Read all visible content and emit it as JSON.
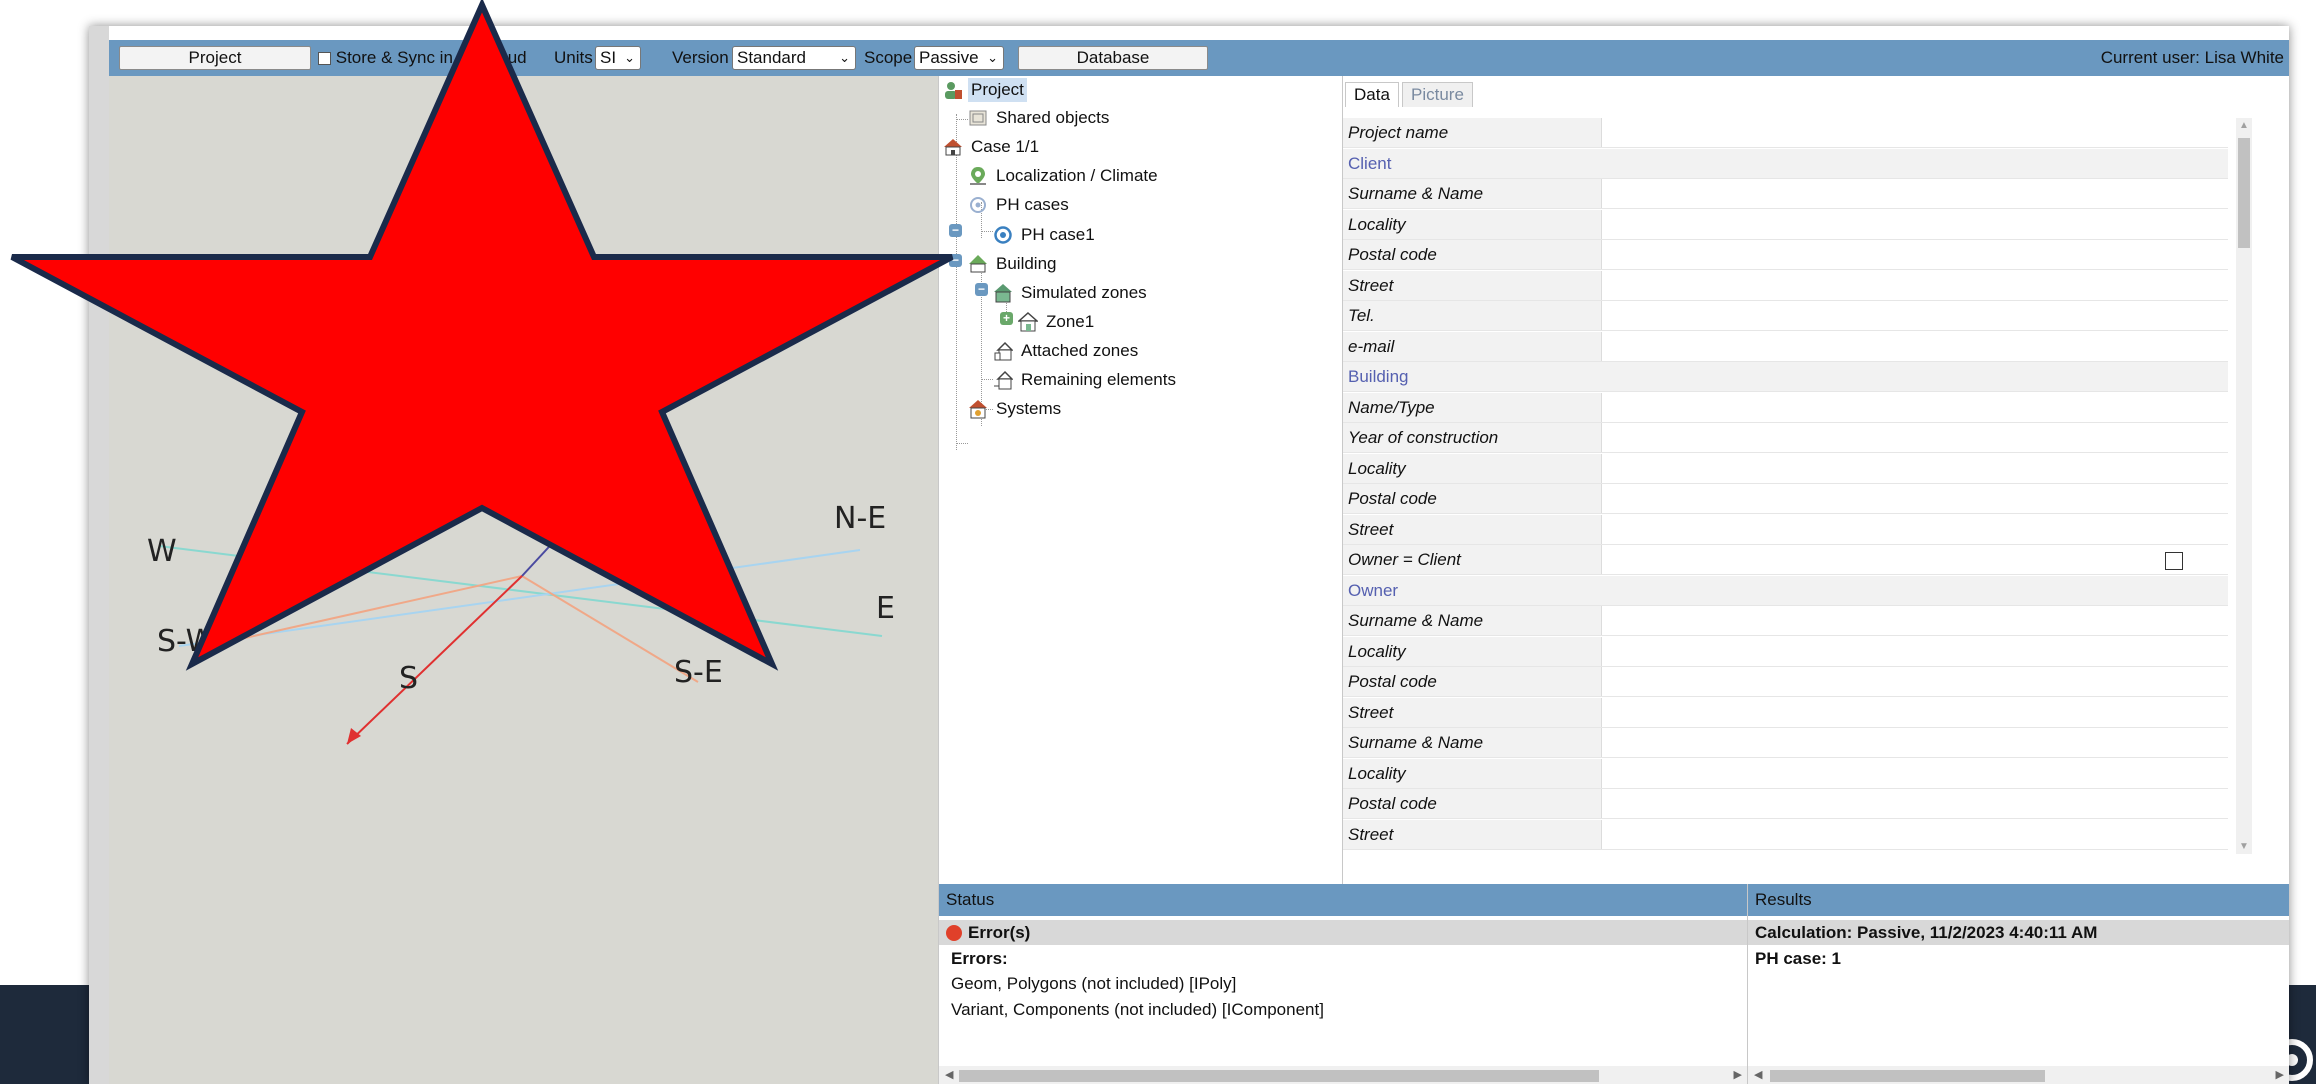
{
  "toolbar": {
    "project_button": "Project",
    "store_sync_label": "Store & Sync in the cloud",
    "units_label": "Units",
    "units_value": "SI",
    "version_label": "Version",
    "version_value": "Standard",
    "scope_label": "Scope",
    "scope_value": "Passive",
    "database_button": "Database",
    "current_user": "Current user: Lisa White"
  },
  "compass": {
    "labels": [
      "W",
      "N-E",
      "S-W",
      "E",
      "S",
      "S-E"
    ]
  },
  "tree": {
    "items": [
      {
        "label": "Project",
        "icon": "project-icon"
      },
      {
        "label": "Shared objects",
        "icon": "shared-objects-icon"
      },
      {
        "label": "Case 1/1",
        "icon": "case-icon"
      },
      {
        "label": "Localization / Climate",
        "icon": "location-pin-icon"
      },
      {
        "label": "PH cases",
        "icon": "ph-cases-icon"
      },
      {
        "label": "PH case1",
        "icon": "ph-case-icon"
      },
      {
        "label": "Building",
        "icon": "building-icon"
      },
      {
        "label": "Simulated zones",
        "icon": "simulated-zones-icon"
      },
      {
        "label": "Zone1",
        "icon": "zone-icon"
      },
      {
        "label": "Attached zones",
        "icon": "attached-zones-icon"
      },
      {
        "label": "Remaining elements",
        "icon": "remaining-elements-icon"
      },
      {
        "label": "Systems",
        "icon": "systems-icon"
      }
    ]
  },
  "data_panel": {
    "tabs": [
      "Data",
      "Picture"
    ],
    "rows": [
      {
        "label": "Project name",
        "type": "field"
      },
      {
        "label": "Client",
        "type": "section"
      },
      {
        "label": "Surname & Name",
        "type": "field"
      },
      {
        "label": "Locality",
        "type": "field"
      },
      {
        "label": "Postal code",
        "type": "field"
      },
      {
        "label": "Street",
        "type": "field"
      },
      {
        "label": "Tel.",
        "type": "field"
      },
      {
        "label": "e-mail",
        "type": "field"
      },
      {
        "label": "Building",
        "type": "section"
      },
      {
        "label": "Name/Type",
        "type": "field"
      },
      {
        "label": "Year of construction",
        "type": "field"
      },
      {
        "label": "Locality",
        "type": "field"
      },
      {
        "label": "Postal code",
        "type": "field"
      },
      {
        "label": "Street",
        "type": "field"
      },
      {
        "label": "Owner = Client",
        "type": "checkbox",
        "checked": false
      },
      {
        "label": "Owner",
        "type": "section"
      },
      {
        "label": "Surname & Name",
        "type": "field"
      },
      {
        "label": "Locality",
        "type": "field"
      },
      {
        "label": "Postal code",
        "type": "field"
      },
      {
        "label": "Street",
        "type": "field"
      },
      {
        "label": "Surname & Name",
        "type": "field"
      },
      {
        "label": "Locality",
        "type": "field"
      },
      {
        "label": "Postal code",
        "type": "field"
      },
      {
        "label": "Street",
        "type": "field"
      }
    ]
  },
  "status": {
    "title": "Status",
    "summary": "Error(s)",
    "errors_heading": "Errors:",
    "errors": [
      "Geom, Polygons (not included) [IPoly]",
      "Variant, Components (not included) [IComponent]"
    ]
  },
  "results": {
    "title": "Results",
    "calculation": "Calculation: Passive, 11/2/2023 4:40:11 AM",
    "ph_case": "PH case: 1"
  },
  "colors": {
    "toolbar": "#6a98c0",
    "star_fill": "#ff0000",
    "star_stroke": "#1a2a4a",
    "error_dot": "#e0402a",
    "section_text": "#5560b0"
  }
}
